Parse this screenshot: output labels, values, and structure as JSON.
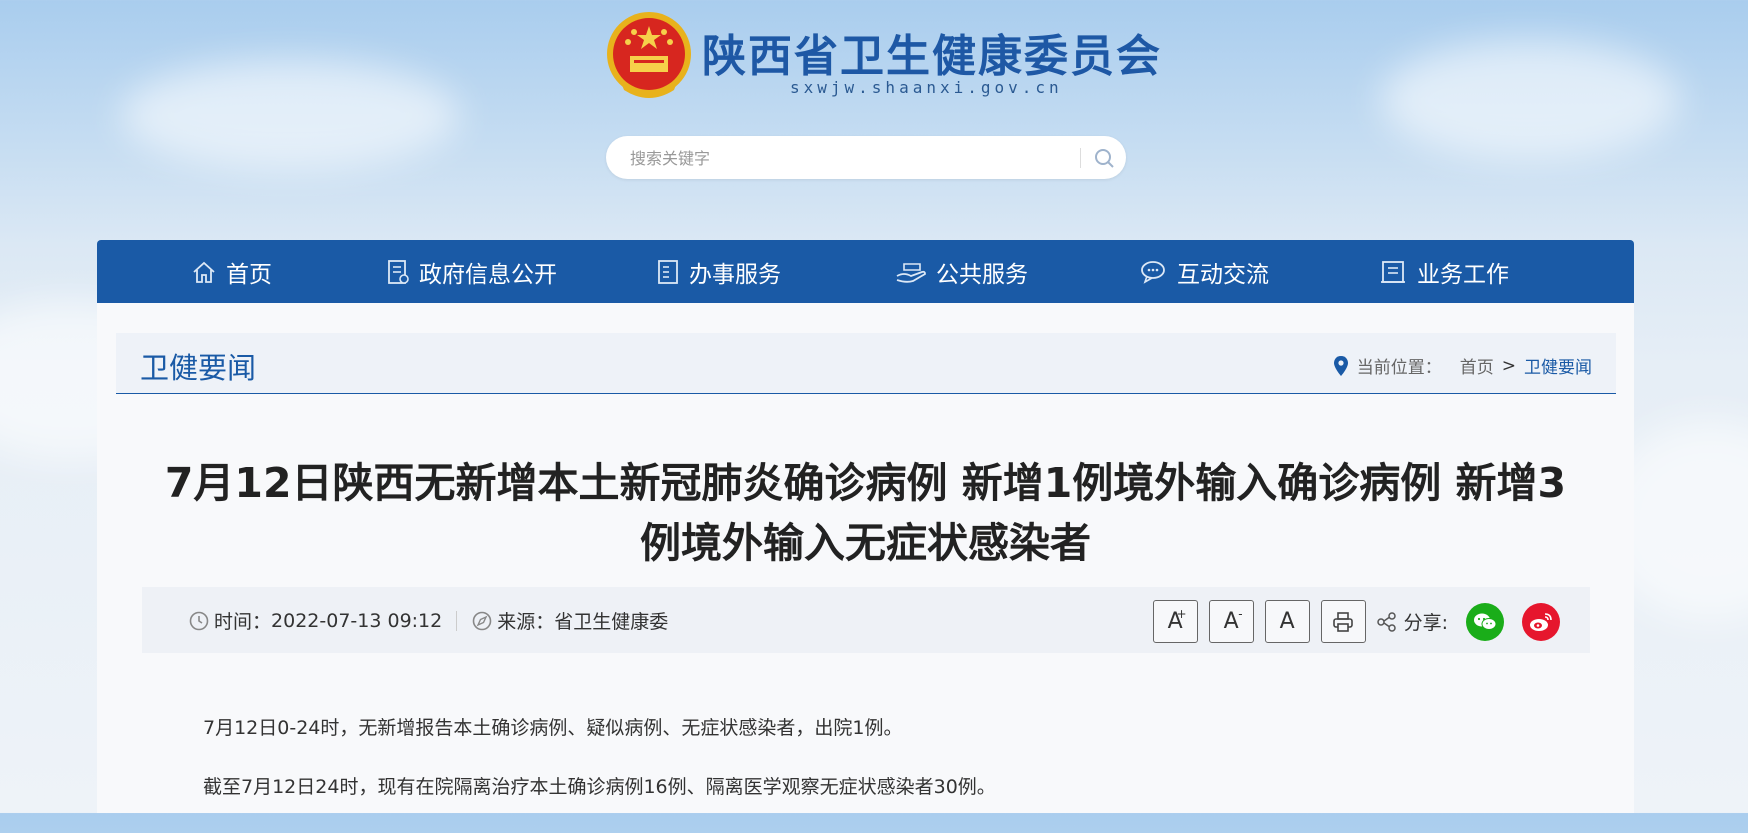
{
  "header": {
    "site_title": "陕西省卫生健康委员会",
    "site_domain": "sxwjw.shaanxi.gov.cn",
    "search_placeholder": "搜索关键字"
  },
  "nav": {
    "items": [
      {
        "label": "首页",
        "icon": "home-icon"
      },
      {
        "label": "政府信息公开",
        "icon": "document-list-icon"
      },
      {
        "label": "办事服务",
        "icon": "clipboard-icon"
      },
      {
        "label": "公共服务",
        "icon": "hand-service-icon"
      },
      {
        "label": "互动交流",
        "icon": "chat-bubble-icon"
      },
      {
        "label": "业务工作",
        "icon": "book-icon"
      }
    ]
  },
  "section": {
    "title": "卫健要闻",
    "breadcrumb_label": "当前位置：",
    "breadcrumb_home": "首页",
    "breadcrumb_sep": ">",
    "breadcrumb_current": "卫健要闻"
  },
  "article": {
    "title": "7月12日陕西无新增本土新冠肺炎确诊病例 新增1例境外输入确诊病例 新增3例境外输入无症状感染者",
    "time_label": "时间：",
    "time_value": "2022-07-13 09:12",
    "source_label": "来源：",
    "source_value": "省卫生健康委",
    "font_large": "A",
    "font_large_mark": "+",
    "font_small": "A",
    "font_small_mark": "-",
    "font_reset": "A",
    "share_label": "分享:",
    "paragraphs": [
      "7月12日0-24时，无新增报告本土确诊病例、疑似病例、无症状感染者，出院1例。",
      "截至7月12日24时，现有在院隔离治疗本土确诊病例16例、隔离医学观察无症状感染者30例。"
    ]
  },
  "colors": {
    "brand_blue": "#1a5aa6",
    "wechat_green": "#1aad19",
    "weibo_red": "#e6162d"
  }
}
